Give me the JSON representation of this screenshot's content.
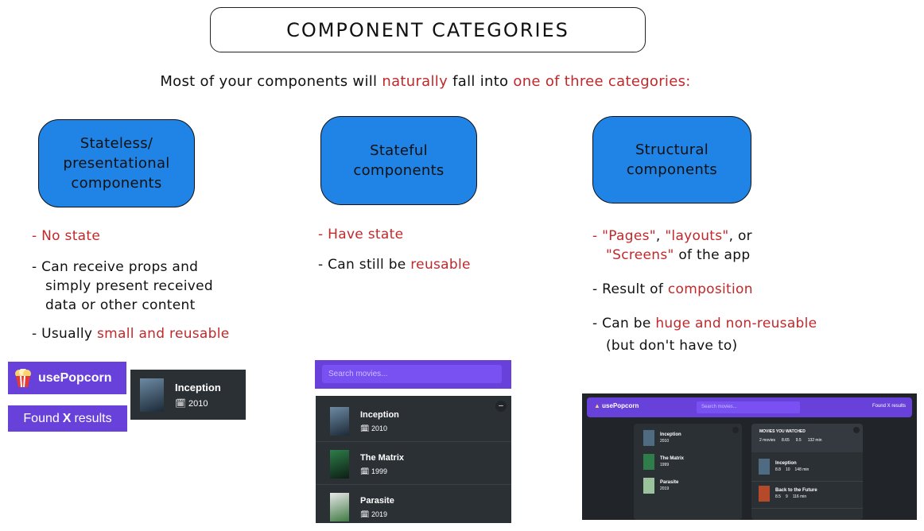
{
  "title": "COMPONENT CATEGORIES",
  "intro": {
    "part1": "Most of your components will ",
    "part2": "naturally",
    "part3": " fall into ",
    "part4": "one of three categories:"
  },
  "categories": [
    {
      "box_lines": [
        "Stateless/",
        "presentational",
        "components"
      ],
      "bullets": [
        {
          "red": "- No state"
        },
        {
          "text": [
            "- Can receive props and",
            "simply present received",
            "data or other content"
          ]
        },
        {
          "prefix": "- Usually ",
          "red": "small and reusable"
        }
      ]
    },
    {
      "box_lines": [
        "Stateful",
        "components"
      ],
      "bullets": [
        {
          "red": "- Have state"
        },
        {
          "prefix": "- Can still be ",
          "red": "reusable"
        }
      ]
    },
    {
      "box_lines": [
        "Structural",
        "components"
      ],
      "bullets": [
        {
          "red1": "- \"Pages\"",
          "mid1": ", ",
          "red2": "\"layouts\"",
          "mid2": ", or",
          "red3": "\"Screens\"",
          "suffix3": " of the app"
        },
        {
          "prefix": "- Result of ",
          "red": "composition"
        },
        {
          "prefix": "- Can be ",
          "red": "huge and non-reusable",
          "line2": "(but don't have to)"
        }
      ]
    }
  ],
  "examples": {
    "logo_label": "usePopcorn",
    "found": {
      "pre": "Found ",
      "bold": "X",
      "post": " results"
    },
    "single_movie": {
      "title": "Inception",
      "year": "2010"
    },
    "search_placeholder": "Search movies...",
    "list_collapse": "–",
    "movies": [
      {
        "title": "Inception",
        "year": "2010"
      },
      {
        "title": "The Matrix",
        "year": "1999"
      },
      {
        "title": "Parasite",
        "year": "2019"
      }
    ],
    "app": {
      "logo_label": "usePopcorn",
      "search_placeholder": "Search movies...",
      "found": "Found X results",
      "list": [
        {
          "title": "Inception",
          "year": "2010"
        },
        {
          "title": "The Matrix",
          "year": "1999"
        },
        {
          "title": "Parasite",
          "year": "2019"
        }
      ],
      "watched_heading": "MOVIES YOU WATCHED",
      "stats": {
        "movies": "2 movies",
        "imdb": "8.65",
        "user": "9.5",
        "runtime": "132 min"
      },
      "watched": [
        {
          "title": "Inception",
          "imdb": "8.8",
          "user": "10",
          "runtime": "148 min"
        },
        {
          "title": "Back to the Future",
          "imdb": "8.5",
          "user": "9",
          "runtime": "116 min"
        }
      ]
    }
  },
  "colors": {
    "box_blue": "#1f84e6",
    "accent_red": "#c0292b",
    "popcorn_purple": "#6741d9",
    "app_dark": "#2b3035"
  }
}
